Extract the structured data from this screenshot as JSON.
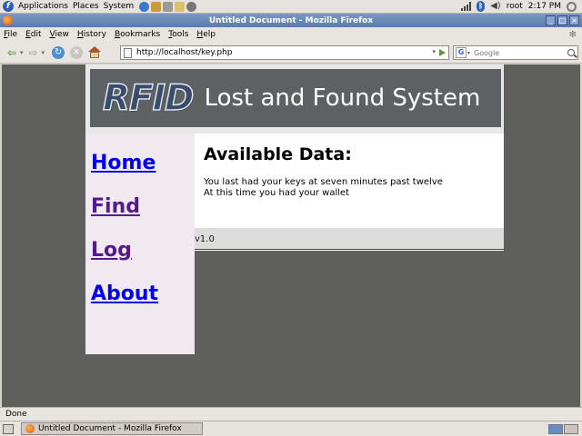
{
  "panel": {
    "menus": [
      "Applications",
      "Places",
      "System"
    ],
    "user": "root",
    "clock": "2:17 PM"
  },
  "window": {
    "title": "Untitled Document - Mozilla Firefox"
  },
  "menubar": {
    "items": [
      "File",
      "Edit",
      "View",
      "History",
      "Bookmarks",
      "Tools",
      "Help"
    ]
  },
  "navigation": {
    "url": "http://localhost/key.php",
    "search_placeholder": "Google"
  },
  "site": {
    "logo_text": "RFID",
    "title": "Lost and Found System",
    "nav": [
      {
        "label": "Home",
        "visited": false
      },
      {
        "label": "Find",
        "visited": true
      },
      {
        "label": "Log",
        "visited": true
      },
      {
        "label": "About",
        "visited": false
      }
    ],
    "heading": "Available Data:",
    "lines": [
      "You last had your keys at seven minutes past twelve",
      "At this time you had your wallet"
    ],
    "version": "v1.0"
  },
  "statusbar": {
    "text": "Done"
  },
  "taskbar": {
    "task_label": "Untitled Document - Mozilla Firefox"
  },
  "colors": {
    "link_unvisited": "#0000ee",
    "link_visited": "#551a8b",
    "banner_bg": "#5e6163",
    "sidebar_bg": "#f0eaf0",
    "viewport_bg": "#5f605e"
  }
}
